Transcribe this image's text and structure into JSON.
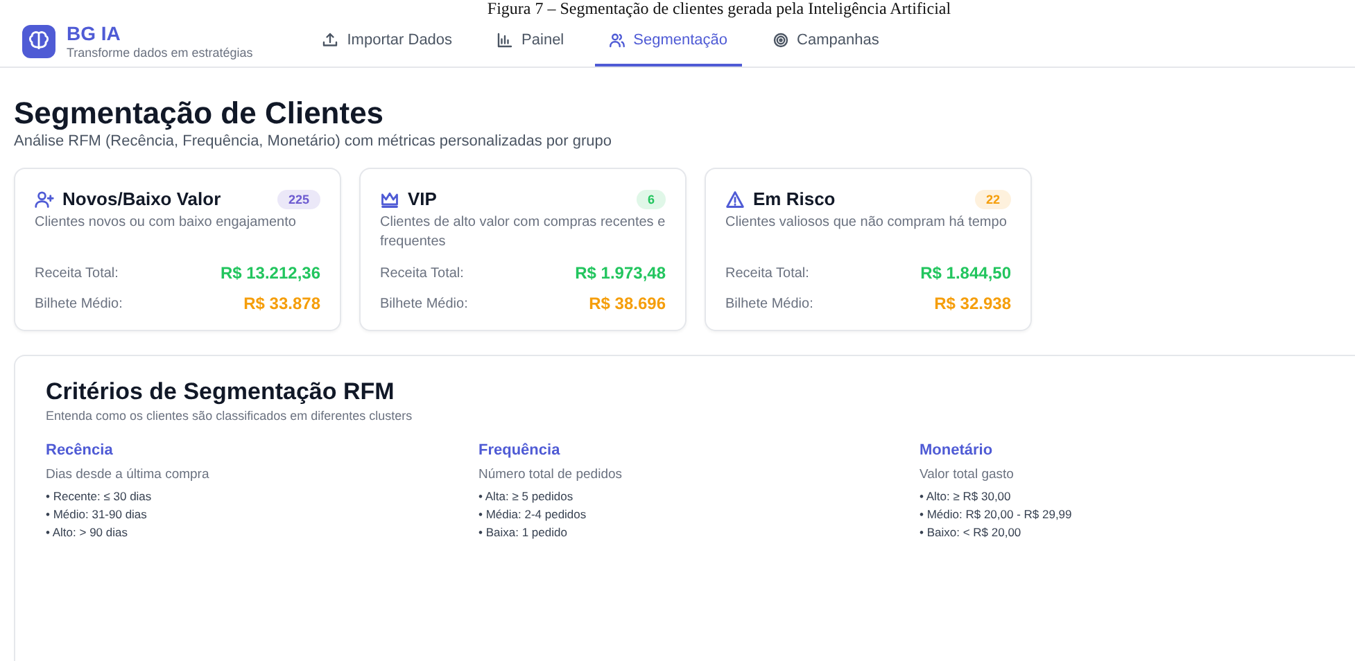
{
  "caption": "Figura 7 – Segmentação de clientes gerada pela Inteligência Artificial",
  "brand": {
    "name": "BG IA",
    "tagline": "Transforme dados em estratégias"
  },
  "tabs": [
    {
      "label": "Importar Dados",
      "kind": "upload",
      "selected": false
    },
    {
      "label": "Painel",
      "kind": "chart",
      "selected": false
    },
    {
      "label": "Segmentação",
      "kind": "users",
      "selected": true
    },
    {
      "label": "Campanhas",
      "kind": "target",
      "selected": false
    }
  ],
  "page": {
    "title": "Segmentação de Clientes",
    "subtitle": "Análise RFM (Recência, Frequência, Monetário) com métricas personalizadas por grupo"
  },
  "segments": [
    {
      "kind": "user-plus",
      "name": "Novos/Baixo Valor",
      "count": "225",
      "color": "#6d5bd0",
      "description": "Clientes novos ou com baixo engajamento",
      "revenue_label": "Receita Total:",
      "revenue": "R$ 13.212,36",
      "ticket_label": "Bilhete Médio:",
      "ticket": "R$ 33.878"
    },
    {
      "kind": "crown",
      "name": "VIP",
      "count": "6",
      "color": "#22c55e",
      "description": "Clientes de alto valor com compras recentes e frequentes",
      "revenue_label": "Receita Total:",
      "revenue": "R$ 1.973,48",
      "ticket_label": "Bilhete Médio:",
      "ticket": "R$ 38.696"
    },
    {
      "kind": "warning",
      "name": "Em Risco",
      "count": "22",
      "color": "#f59e0b",
      "description": "Clientes valiosos que não compram há tempo",
      "revenue_label": "Receita Total:",
      "revenue": "R$ 1.844,50",
      "ticket_label": "Bilhete Médio:",
      "ticket": "R$ 32.938"
    }
  ],
  "criteria": {
    "title": "Critérios de Segmentação RFM",
    "subtitle": "Entenda como os clientes são classificados em diferentes clusters",
    "columns": [
      {
        "title": "Recência",
        "description": "Dias desde a última compra",
        "items": [
          "• Recente: ≤ 30 dias",
          "• Médio: 31-90 dias",
          "• Alto: > 90 dias"
        ]
      },
      {
        "title": "Frequência",
        "description": "Número total de pedidos",
        "items": [
          "• Alta: ≥ 5 pedidos",
          "• Média: 2-4 pedidos",
          "• Baixa: 1 pedido"
        ]
      },
      {
        "title": "Monetário",
        "description": "Valor total gasto",
        "items": [
          "• Alto: ≥ R$ 30,00",
          "• Médio: R$ 20,00 - R$ 29,99",
          "• Baixo: < R$ 20,00"
        ]
      }
    ]
  }
}
